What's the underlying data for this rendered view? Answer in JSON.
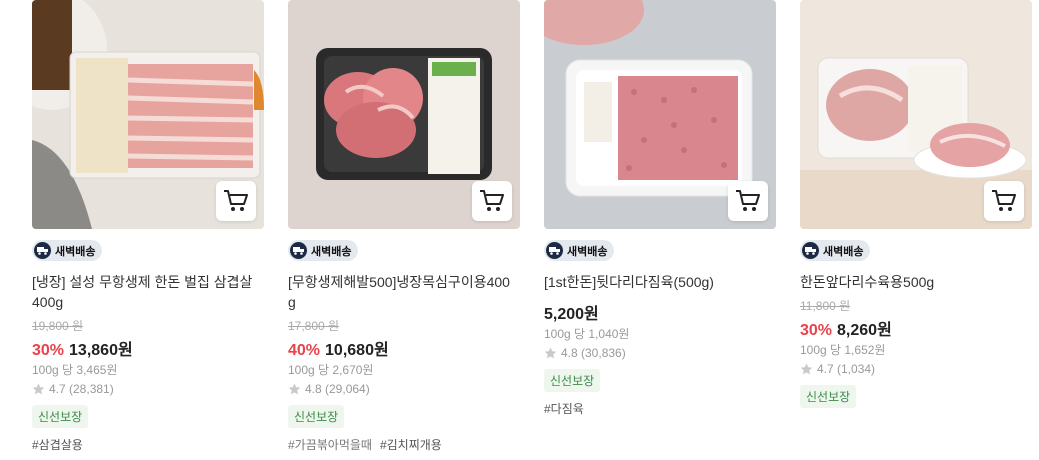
{
  "products": [
    {
      "badge": "새벽배송",
      "title": "[냉장] 설성 무항생제 한돈 벌집 삼겹살 400g",
      "original_price": "19,800 원",
      "discount": "30%",
      "price": "13,860원",
      "unit_price": "100g 당 3,465원",
      "rating": "4.7 (28,381)",
      "tag": "신선보장",
      "hashtags": [
        "#삼겹살용"
      ],
      "image": "pork-belly-tray"
    },
    {
      "badge": "새벽배송",
      "title": "[무항생제해발500]냉장목심구이용400g",
      "original_price": "17,800 원",
      "discount": "40%",
      "price": "10,680원",
      "unit_price": "100g 당 2,670원",
      "rating": "4.8 (29,064)",
      "tag": "신선보장",
      "hashtags": [
        "#가끔볶아먹을때",
        "#김치찌개용"
      ],
      "image": "pork-neck-black-tray"
    },
    {
      "badge": "새벽배송",
      "title": "[1st한돈]뒷다리다짐육(500g)",
      "original_price": "",
      "discount": "",
      "price": "5,200원",
      "unit_price": "100g 당 1,040원",
      "rating": "4.8 (30,836)",
      "tag": "신선보장",
      "hashtags": [
        "#다짐육"
      ],
      "image": "ground-pork-tray"
    },
    {
      "badge": "새벽배송",
      "title": "한돈앞다리수육용500g",
      "original_price": "11,800 원",
      "discount": "30%",
      "price": "8,260원",
      "unit_price": "100g 당 1,652원",
      "rating": "4.7 (1,034)",
      "tag": "신선보장",
      "hashtags": [],
      "image": "pork-shoulder-plate"
    }
  ],
  "icons": {
    "cart": "cart-icon",
    "delivery": "truck-icon",
    "star": "star-icon"
  },
  "colors": {
    "discount": "#e8434c",
    "tag_bg": "#eef6ee",
    "tag_text": "#3c8a4b",
    "badge_bg": "#e4e8ef"
  }
}
